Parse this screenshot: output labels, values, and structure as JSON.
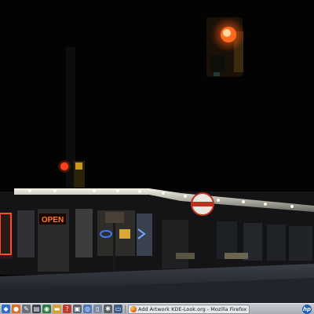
{
  "wallpaper": {
    "sign_text": "OPEN",
    "colors": {
      "sky": "#030303",
      "neon_orange": "#ff6a1a",
      "neon_blue": "#3a7bff",
      "traffic_red": "#ff5a18"
    }
  },
  "taskbar": {
    "launchers": [
      {
        "name": "kde-menu-icon",
        "glyph": "◆",
        "color": "#2f6fc9"
      },
      {
        "name": "firefox-icon",
        "glyph": "●",
        "color": "#e06a1e"
      },
      {
        "name": "pen-icon",
        "glyph": "✎",
        "color": "#6b7078"
      },
      {
        "name": "terminal-icon",
        "glyph": "▤",
        "color": "#3c4250"
      },
      {
        "name": "media-icon",
        "glyph": "◉",
        "color": "#2a7d3a"
      },
      {
        "name": "folder-icon",
        "glyph": "▬",
        "color": "#d6a234"
      },
      {
        "name": "help-icon",
        "glyph": "?",
        "color": "#c13c2e"
      },
      {
        "name": "shell-icon",
        "glyph": "▣",
        "color": "#55606f"
      },
      {
        "name": "network-icon",
        "glyph": "◎",
        "color": "#4d77b8"
      },
      {
        "name": "document-icon",
        "glyph": "▯",
        "color": "#7a8aa0"
      },
      {
        "name": "settings-icon",
        "glyph": "✱",
        "color": "#5b5f66"
      },
      {
        "name": "monitor-icon",
        "glyph": "▭",
        "color": "#3f5d86"
      }
    ],
    "task_label": "Add Artwork KDE-Look.org - Mozilla Firefox",
    "tray_logo": "hp"
  }
}
